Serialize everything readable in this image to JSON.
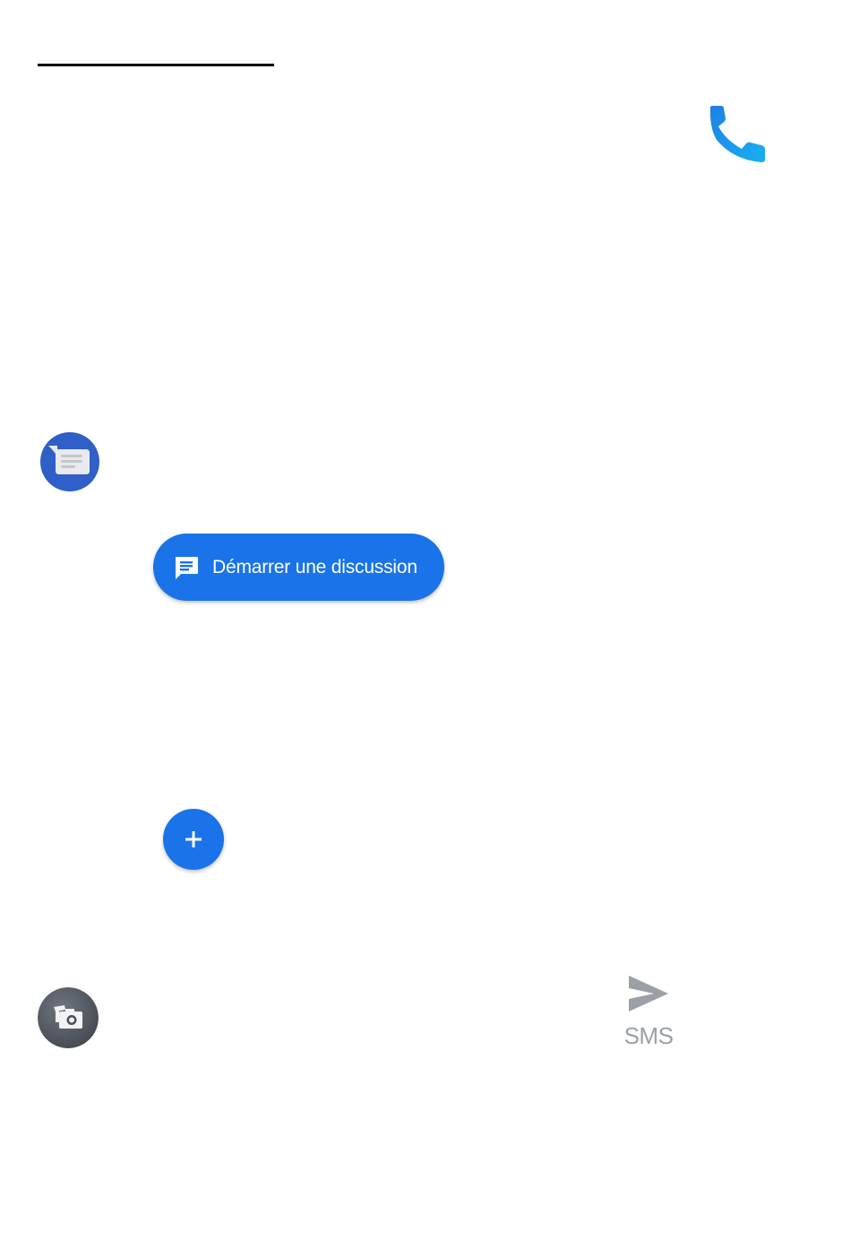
{
  "header": {
    "call_icon": "phone-icon",
    "call_icon_color": "#1a9be8"
  },
  "app": {
    "icon": "messages-app-icon",
    "icon_color": "#2f5fc7"
  },
  "start_chat": {
    "label": "Démarrer une discussion",
    "icon": "chat-icon",
    "color": "#1a73e8"
  },
  "add": {
    "icon": "plus-icon",
    "color": "#1a73e8"
  },
  "composer": {
    "attach_icon": "gallery-camera-icon",
    "send_icon": "send-icon",
    "send_label": "SMS",
    "send_color": "#9aa0a6"
  }
}
